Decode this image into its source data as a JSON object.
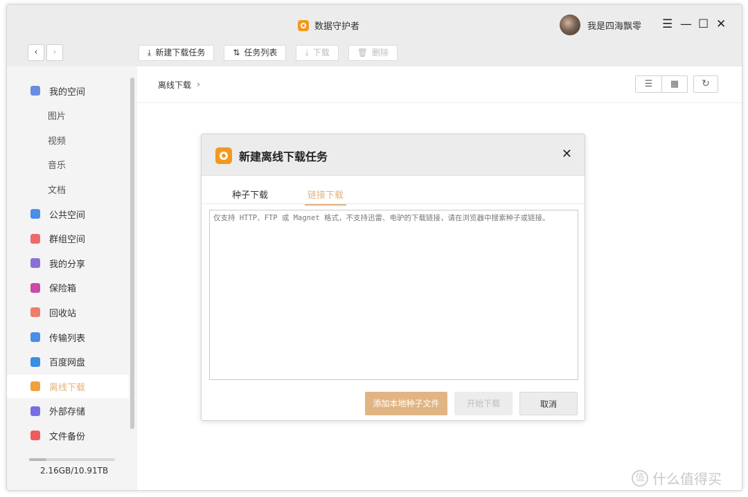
{
  "app": {
    "title": "数据守护者",
    "user_name": "我是四海飘零"
  },
  "window_controls": {
    "menu": "☰",
    "minimize": "—",
    "maximize": "☐",
    "close": "✕"
  },
  "nav": {
    "back": "‹",
    "forward": "›"
  },
  "toolbar": {
    "new_task": {
      "icon": "⤓",
      "label": "新建下载任务"
    },
    "task_list": {
      "icon": "⇅",
      "label": "任务列表"
    },
    "download": {
      "icon": "⤓",
      "label": "下载"
    },
    "delete": {
      "icon": "🗑",
      "label": "删除"
    }
  },
  "sidebar": {
    "items": [
      {
        "label": "我的空间",
        "icon": "folder-icon",
        "color": "#6a8de0"
      },
      {
        "label": "图片",
        "sub": true
      },
      {
        "label": "视频",
        "sub": true
      },
      {
        "label": "音乐",
        "sub": true
      },
      {
        "label": "文档",
        "sub": true
      },
      {
        "label": "公共空间",
        "icon": "send-icon",
        "color": "#4a8ee6"
      },
      {
        "label": "群组空间",
        "icon": "group-icon",
        "color": "#ec6b6b"
      },
      {
        "label": "我的分享",
        "icon": "share-icon",
        "color": "#8a6fd8"
      },
      {
        "label": "保险箱",
        "icon": "safe-icon",
        "color": "#c94aa8"
      },
      {
        "label": "回收站",
        "icon": "trash-icon",
        "color": "#f07c6a"
      },
      {
        "label": "传输列表",
        "icon": "transfer-icon",
        "color": "#4a8ee6"
      },
      {
        "label": "百度网盘",
        "icon": "cloud-icon",
        "color": "#3b8de6"
      },
      {
        "label": "离线下载",
        "icon": "download-icon",
        "color": "#f2a03c",
        "active": true
      },
      {
        "label": "外部存储",
        "icon": "drive-icon",
        "color": "#7a6ee6"
      },
      {
        "label": "文件备份",
        "icon": "backup-icon",
        "color": "#ef5b5b"
      }
    ],
    "storage": "2.16GB/10.91TB",
    "storage_used_fraction": 0.2
  },
  "main": {
    "breadcrumb": "离线下载",
    "breadcrumb_sep": "›",
    "view_list": "☰",
    "view_grid": "▦",
    "refresh": "↻"
  },
  "dialog": {
    "title": "新建离线下载任务",
    "close": "✕",
    "tabs": [
      {
        "label": "种子下载",
        "active": false
      },
      {
        "label": "链接下载",
        "active": true
      }
    ],
    "placeholder": "仅支持 HTTP、FTP 或 Magnet 格式，不支持迅雷、电驴的下载链接，请在浏览器中搜索种子或链接。",
    "btn_add_torrent": "添加本地种子文件",
    "btn_start": "开始下载",
    "btn_cancel": "取消"
  },
  "watermark": {
    "icon": "值",
    "text": "什么值得买"
  },
  "colors": {
    "accent": "#e4b27a",
    "titlebar": "#ececec",
    "sidebar": "#f4f4f4"
  }
}
